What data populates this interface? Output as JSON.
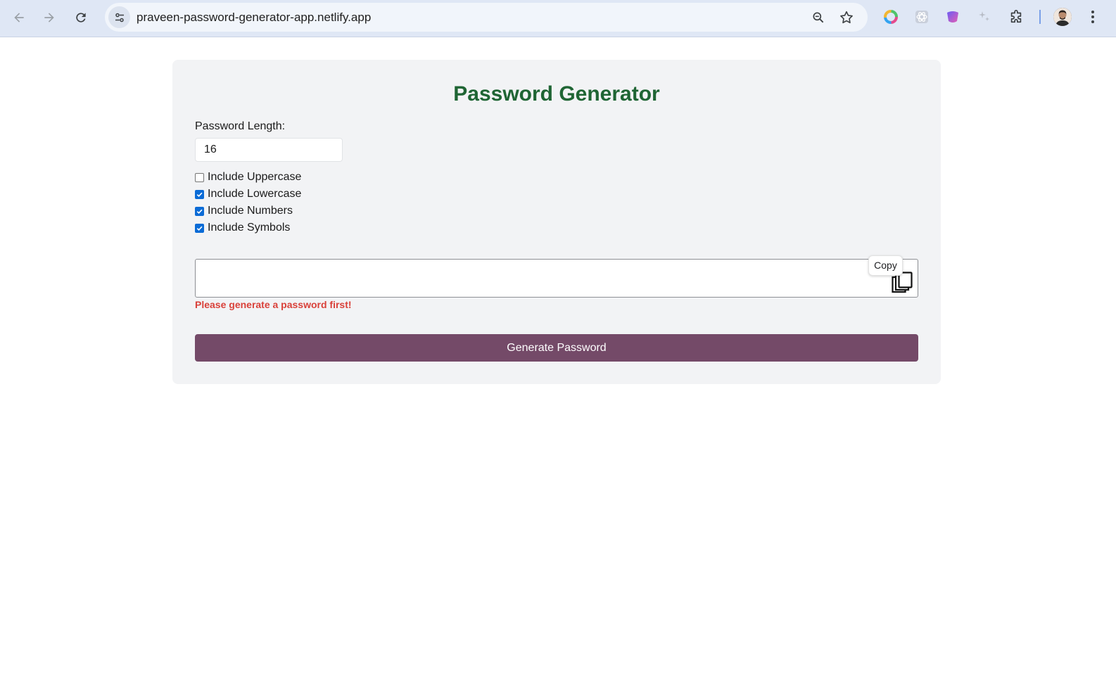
{
  "browser": {
    "url": "praveen-password-generator-app.netlify.app"
  },
  "app": {
    "title": "Password Generator",
    "length_label": "Password Length:",
    "length_value": "16",
    "options": [
      {
        "label": "Include Uppercase",
        "checked": false
      },
      {
        "label": "Include Lowercase",
        "checked": true
      },
      {
        "label": "Include Numbers",
        "checked": true
      },
      {
        "label": "Include Symbols",
        "checked": true
      }
    ],
    "password_output": "",
    "copy_tooltip": "Copy",
    "error_message": "Please generate a password first!",
    "generate_button": "Generate Password"
  },
  "colors": {
    "title": "#1f6534",
    "button": "#744a68",
    "error": "#d9413a",
    "card_bg": "#f2f3f5",
    "checkbox_accent": "#0b6bd6"
  }
}
